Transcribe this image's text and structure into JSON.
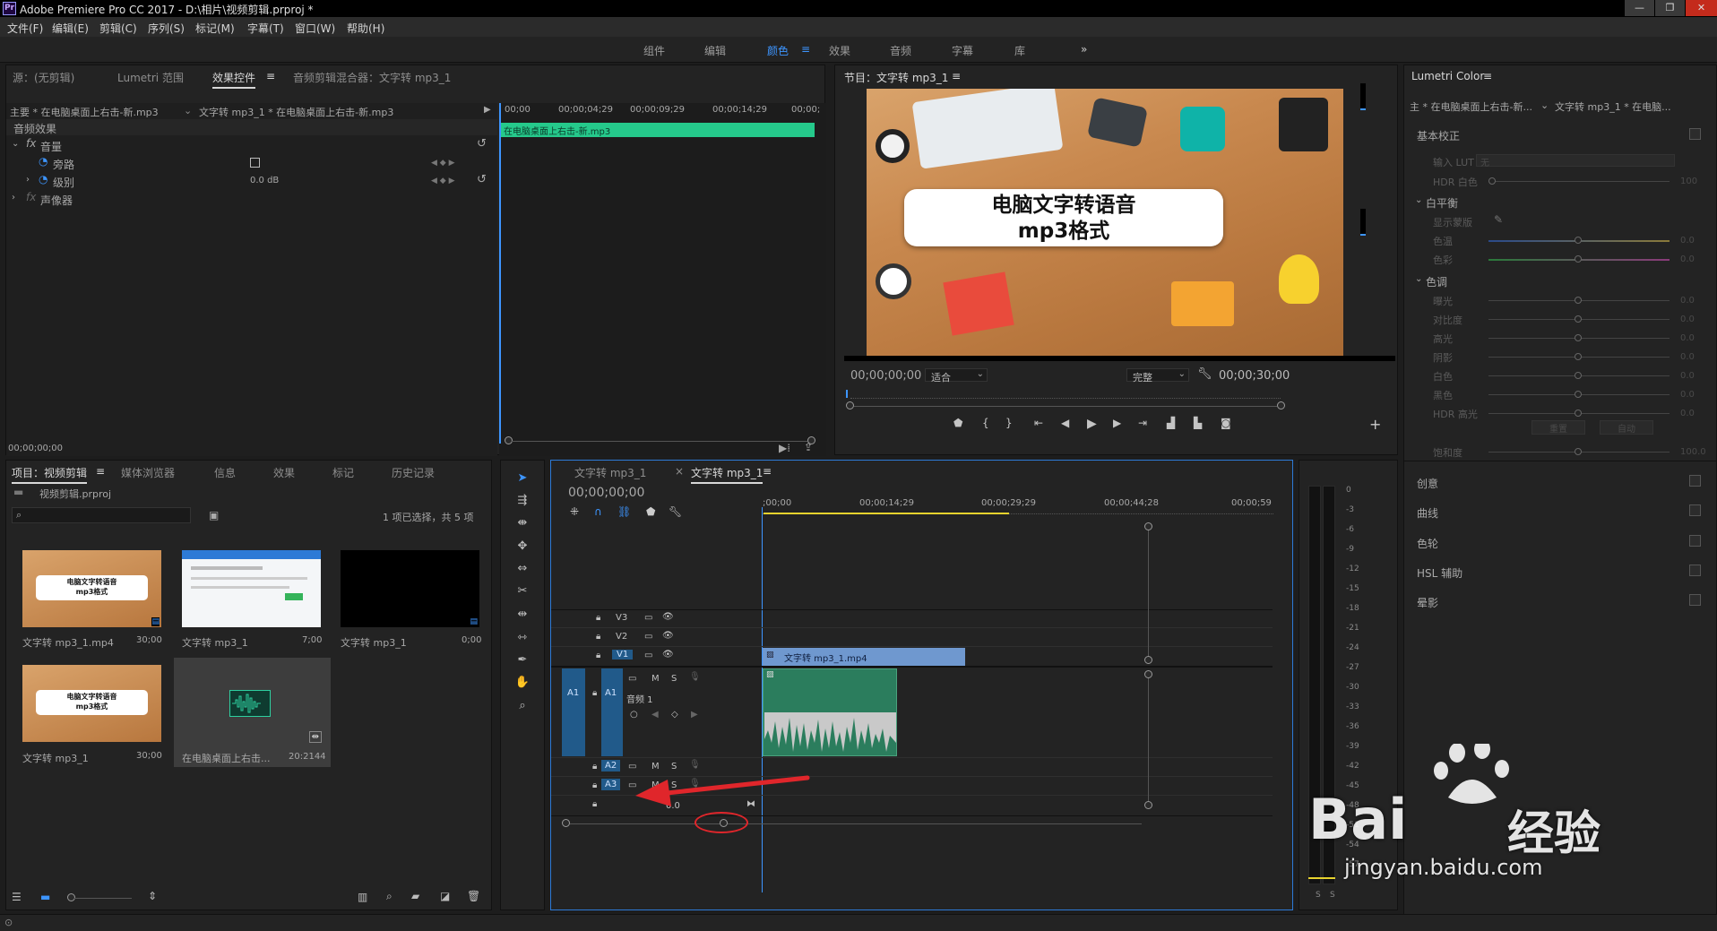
{
  "window": {
    "title": "Adobe Premiere Pro CC 2017 - D:\\相片\\视频剪辑.prproj *",
    "logo": "Pr",
    "min": "—",
    "max": "❐",
    "close": "✕"
  },
  "menu": [
    "文件(F)",
    "编辑(E)",
    "剪辑(C)",
    "序列(S)",
    "标记(M)",
    "字幕(T)",
    "窗口(W)",
    "帮助(H)"
  ],
  "workspaces": [
    "组件",
    "编辑",
    "颜色",
    "效果",
    "音频",
    "字幕",
    "库"
  ],
  "workspace_active": "颜色",
  "workspace_more": "»",
  "source_panel": {
    "tabs": [
      "源：(无剪辑)",
      "Lumetri 范围",
      "效果控件",
      "音频剪辑混合器：文字转 mp3_1"
    ],
    "master": "主要 * 在电脑桌面上右击-新.mp3",
    "clip": "文字转 mp3_1 * 在电脑桌面上右击-新.mp3",
    "ruler": [
      "00;00",
      "00;00;04;29",
      "00;00;09;29",
      "00;00;14;29",
      "00;00;"
    ],
    "clipbar": "在电脑桌面上右击-新.mp3",
    "section": "音频效果",
    "fx_label": "fx",
    "volume": "音量",
    "bypass": "旁路",
    "level": "级别",
    "level_val": "0.0 dB",
    "panner": "声像器",
    "timecode": "00;00;00;00"
  },
  "program": {
    "title": "节目：文字转 mp3_1",
    "video_line1": "电脑文字转语音",
    "video_line2": "mp3格式",
    "timecode": "00;00;00;00",
    "fit": "适合",
    "quality": "完整",
    "duration": "00;00;30;00"
  },
  "project": {
    "tabs": [
      "项目：视频剪辑",
      "媒体浏览器",
      "信息",
      "效果",
      "标记",
      "历史记录"
    ],
    "file": "视频剪辑.prproj",
    "selection": "1 项已选择，共 5 项",
    "items": [
      {
        "name": "文字转 mp3_1.mp4",
        "dur": "30;00"
      },
      {
        "name": "文字转 mp3_1",
        "dur": "7;00"
      },
      {
        "name": "文字转 mp3_1",
        "dur": "0;00"
      },
      {
        "name": "文字转 mp3_1",
        "dur": "30;00"
      },
      {
        "name": "在电脑桌面上右击...",
        "dur": "20:2144"
      }
    ],
    "thumb_line1": "电脑文字转语音",
    "thumb_line2": "mp3格式"
  },
  "timeline": {
    "tabs": [
      "文字转 mp3_1",
      "文字转 mp3_1"
    ],
    "tab_close": "×",
    "timecode": "00;00;00;00",
    "ruler": [
      ";00;00",
      "00;00;14;29",
      "00;00;29;29",
      "00;00;44;28",
      "00;00;59"
    ],
    "video_tracks": [
      "V3",
      "V2",
      "V1"
    ],
    "audio_tracks": [
      "A1",
      "A2",
      "A3"
    ],
    "audio_label": "音频 1",
    "m": "M",
    "s": "S",
    "video_clip": "文字转 mp3_1.mp4",
    "master_val": "0.0"
  },
  "vu": {
    "ticks": [
      "0",
      "-3",
      "-6",
      "-9",
      "-12",
      "-15",
      "-18",
      "-21",
      "-24",
      "-27",
      "-30",
      "-33",
      "-36",
      "-39",
      "-42",
      "-45",
      "-48",
      "-51",
      "-54",
      "-57"
    ],
    "s": "S"
  },
  "lumetri": {
    "title": "Lumetri Color",
    "master": "主 * 在电脑桌面上右击-新...",
    "clip": "文字转 mp3_1 * 在电脑...",
    "basic": "基本校正",
    "input_lut": "输入 LUT",
    "input_lut_val": "无",
    "hdr_white": "HDR 白色",
    "hdr_white_val": "100",
    "white_balance": "白平衡",
    "wb_selector": "显示蒙版",
    "temp": "色温",
    "tint": "色彩",
    "tone": "色调",
    "tone_rows": [
      "曝光",
      "对比度",
      "高光",
      "阴影",
      "白色",
      "黑色",
      "HDR 高光"
    ],
    "zero": "0.0",
    "reset": "重置",
    "auto": "自动",
    "saturation": "饱和度",
    "sat_val": "100.0",
    "sections": [
      "创意",
      "曲线",
      "色轮",
      "HSL 辅助",
      "晕影"
    ]
  },
  "watermark": {
    "text1": "Bai",
    "text2": "经验",
    "url": "jingyan.baidu.com"
  }
}
